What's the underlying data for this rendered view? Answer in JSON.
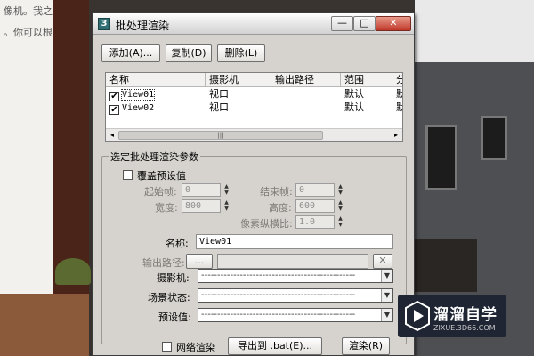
{
  "background": {
    "left_text_1": "像机。我之",
    "left_text_2": "。你可以根"
  },
  "dialog": {
    "title": "批处理渲染",
    "window_controls": {
      "minimize": "—",
      "maximize": "□",
      "close": "✕"
    },
    "toolbar": {
      "add": "添加(A)...",
      "copy": "复制(D)",
      "delete": "删除(L)"
    },
    "list": {
      "columns": [
        "名称",
        "摄影机",
        "输出路径",
        "范围",
        "分"
      ],
      "rows": [
        {
          "checked": true,
          "name": "View01",
          "camera": "视口",
          "output": "",
          "range": "默认",
          "extra": "默"
        },
        {
          "checked": true,
          "name": "View02",
          "camera": "视口",
          "output": "",
          "range": "默认",
          "extra": "默"
        }
      ],
      "scroll_left": "◂",
      "scroll_right": "▸",
      "scroll_thumb": "|||"
    },
    "params": {
      "group_title": "选定批处理渲染参数",
      "override_label": "覆盖预设值",
      "override_checked": false,
      "start_frame_label": "起始帧:",
      "start_frame_value": "0",
      "end_frame_label": "结束帧:",
      "end_frame_value": "0",
      "width_label": "宽度:",
      "width_value": "800",
      "height_label": "高度:",
      "height_value": "600",
      "aspect_label": "像素纵横比:",
      "aspect_value": "1.0",
      "name_label": "名称:",
      "name_value": "View01",
      "output_label": "输出路径:",
      "output_browse": "...",
      "output_value": "",
      "output_clear": "✕",
      "camera_label": "摄影机:",
      "camera_value": "------------------------------------------------",
      "scene_state_label": "场景状态:",
      "scene_state_value": "------------------------------------------------",
      "preset_label": "预设值:",
      "preset_value": "------------------------------------------------"
    },
    "footer": {
      "net_render_label": "网络渲染",
      "net_render_checked": false,
      "export_bat": "导出到 .bat(E)...",
      "render": "渲染(R)"
    }
  },
  "watermark": {
    "title": "溜溜自学",
    "url": "ZIXUE.3D66.COM"
  }
}
